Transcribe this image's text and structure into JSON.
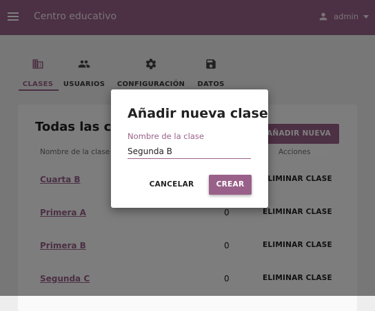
{
  "appbar": {
    "title": "Centro educativo",
    "menu_icon": "menu-icon",
    "user": {
      "icon": "person-icon",
      "name": "admin",
      "caret_icon": "arrow-drop-down-icon"
    }
  },
  "tabs": [
    {
      "label": "CLASES",
      "icon": "business-icon",
      "active": true
    },
    {
      "label": "USUARIOS",
      "icon": "people-icon",
      "active": false
    },
    {
      "label": "CONFIGURACIÓN",
      "icon": "settings-icon",
      "active": false
    },
    {
      "label": "DATOS",
      "icon": "save-icon",
      "active": false
    }
  ],
  "classes": {
    "title": "Todas las clases",
    "add_button": "AÑADIR NUEVA CLASE",
    "columns": {
      "name": "Nombre de la clase",
      "students": "",
      "actions": "Acciones"
    },
    "rows": [
      {
        "name": "Cuarta B",
        "count": "0",
        "action": "ELIMINAR CLASE"
      },
      {
        "name": "Primera A",
        "count": "0",
        "action": "ELIMINAR CLASE"
      },
      {
        "name": "Primera B",
        "count": "0",
        "action": "ELIMINAR CLASE"
      },
      {
        "name": "Segunda C",
        "count": "0",
        "action": "ELIMINAR CLASE"
      }
    ]
  },
  "dialog": {
    "title": "Añadir nueva clase",
    "field_label": "Nombre de la clase",
    "field_value": "Segunda B",
    "cancel": "CANCELAR",
    "create": "CREAR"
  },
  "colors": {
    "primary": "#996189",
    "overlay": "rgba(0,0,0,0.5)"
  }
}
